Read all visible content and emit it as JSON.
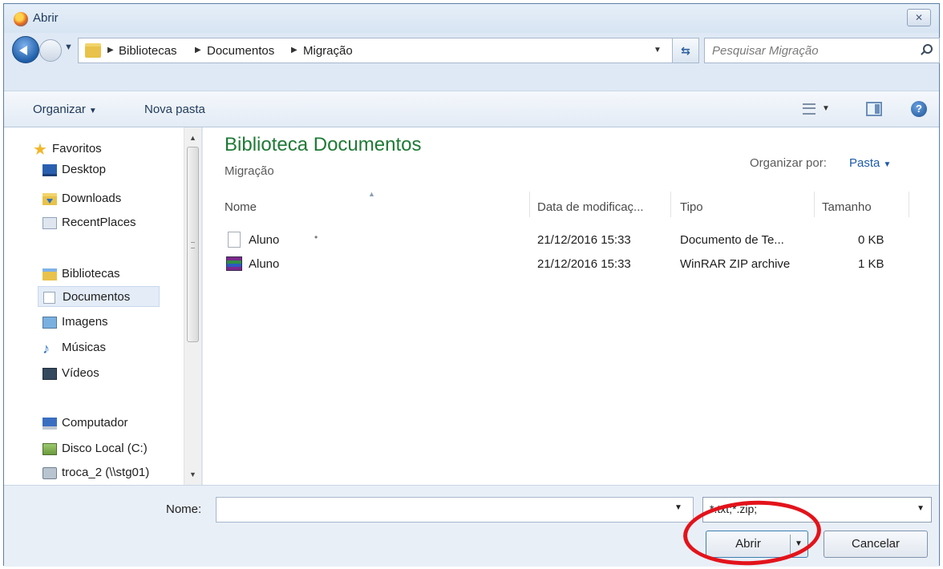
{
  "window": {
    "title": "Abrir"
  },
  "address": {
    "crumbs": [
      "Bibliotecas",
      "Documentos",
      "Migração"
    ],
    "search_placeholder": "Pesquisar Migração"
  },
  "toolbar": {
    "organize_label": "Organizar",
    "new_folder_label": "Nova pasta"
  },
  "nav": {
    "favorites_label": "Favoritos",
    "favorites": [
      "Desktop",
      "Downloads",
      "RecentPlaces"
    ],
    "libraries_label": "Bibliotecas",
    "libraries": [
      "Documentos",
      "Imagens",
      "Músicas",
      "Vídeos"
    ],
    "computer_label": "Computador",
    "computer": [
      "Disco Local (C:)",
      "troca_2 (\\\\stg01)"
    ],
    "selected": "Documentos"
  },
  "content": {
    "title": "Biblioteca Documentos",
    "subtitle": "Migração",
    "arrange_label": "Organizar por:",
    "arrange_value": "Pasta",
    "columns": [
      "Nome",
      "Data de modificaç...",
      "Tipo",
      "Tamanho"
    ],
    "files": [
      {
        "name": "Aluno",
        "date": "21/12/2016 15:33",
        "type": "Documento de Te...",
        "size": "0 KB",
        "icon": "text-file-icon"
      },
      {
        "name": "Aluno",
        "date": "21/12/2016 15:33",
        "type": "WinRAR ZIP archive",
        "size": "1 KB",
        "icon": "rar-archive-icon"
      }
    ]
  },
  "footer": {
    "filename_label": "Nome:",
    "filename_value": "",
    "filter_value": "*.txt;*.zip;",
    "open_label": "Abrir",
    "cancel_label": "Cancelar"
  },
  "colors": {
    "title_green": "#1e7a35",
    "highlight_red": "#e3131b",
    "link_blue": "#1e5aa8"
  }
}
